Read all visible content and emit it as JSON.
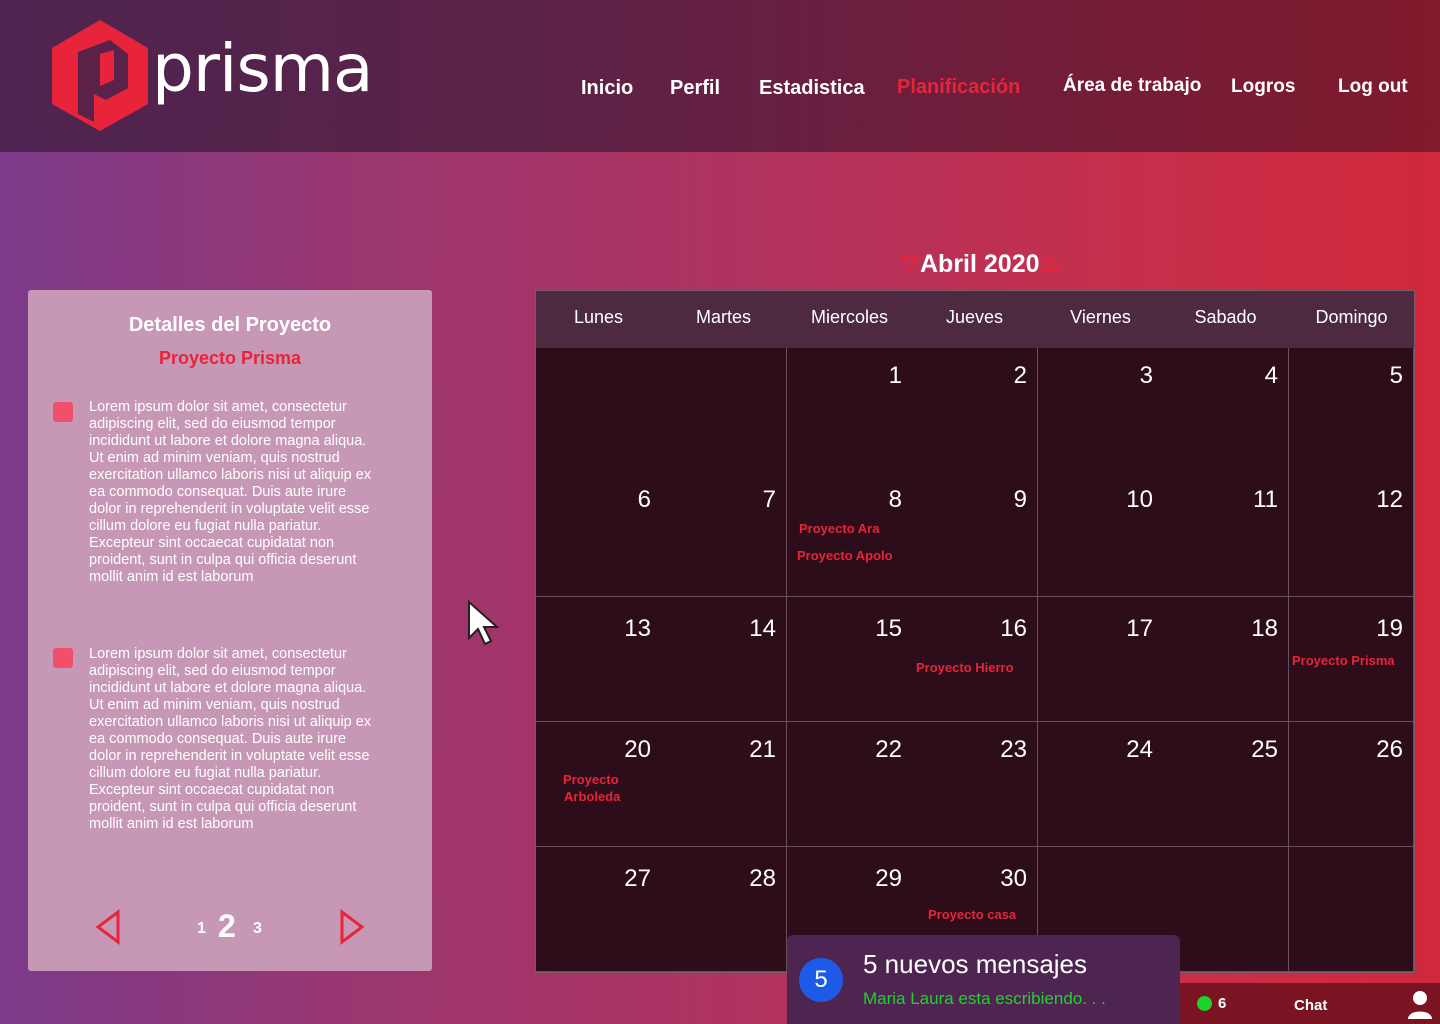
{
  "brand": {
    "name": "prisma",
    "colors": {
      "accent": "#e8243a",
      "header": "#5a2248",
      "cell": "#2e0d1a"
    }
  },
  "nav": [
    {
      "label": "Inicio"
    },
    {
      "label": "Perfil"
    },
    {
      "label": "Estadistica"
    },
    {
      "label": "Planificación",
      "active": true
    },
    {
      "label": "Área de trabajo"
    },
    {
      "label": "Logros"
    },
    {
      "label": "Log out"
    }
  ],
  "calendar": {
    "month": "Abril 2020",
    "days": [
      "Lunes",
      "Martes",
      "Miercoles",
      "Jueves",
      "Viernes",
      "Sabado",
      "Domingo"
    ],
    "weeks": [
      [
        "",
        "",
        "1",
        "2",
        "3",
        "4",
        "5"
      ],
      [
        "6",
        "7",
        "8",
        "9",
        "10",
        "11",
        "12"
      ],
      [
        "13",
        "14",
        "15",
        "16",
        "17",
        "18",
        "19"
      ],
      [
        "20",
        "21",
        "22",
        "23",
        "24",
        "25",
        "26"
      ],
      [
        "27",
        "28",
        "29",
        "30",
        "",
        "",
        ""
      ]
    ],
    "events": {
      "e8a": "Proyecto Ara",
      "e8b": "Proyecto Apolo",
      "e16": "Proyecto Hierro",
      "e19": "Proyecto Prisma",
      "e20a": "Proyecto",
      "e20b": "Arboleda",
      "e30": "Proyecto casa"
    }
  },
  "panel": {
    "title": "Detalles del Proyecto",
    "project": "Proyecto Prisma",
    "paragraph1": "Lorem ipsum dolor sit amet, consectetur adipiscing elit, sed do eiusmod tempor incididunt ut labore et dolore magna aliqua. Ut enim ad minim veniam, quis nostrud exercitation ullamco laboris nisi ut aliquip ex ea commodo consequat. Duis aute irure dolor in reprehenderit in voluptate velit esse cillum dolore eu fugiat nulla pariatur. Excepteur sint occaecat cupidatat non proident, sunt in culpa qui officia deserunt mollit anim id est laborum",
    "paragraph2": "Lorem ipsum dolor sit amet, consectetur adipiscing elit, sed do eiusmod tempor incididunt ut labore et dolore magna aliqua. Ut enim ad minim veniam, quis nostrud exercitation ullamco laboris nisi ut aliquip ex ea commodo consequat. Duis aute irure dolor in reprehenderit in voluptate velit esse cillum dolore eu fugiat nulla pariatur. Excepteur sint occaecat cupidatat non proident, sunt in culpa qui officia deserunt mollit anim id est laborum",
    "pages": [
      "1",
      "2",
      "3"
    ],
    "current_page": "2"
  },
  "chat": {
    "badge": "5",
    "title": "5 nuevos mensajes",
    "typing": "Maria Laura esta escribiendo. . .",
    "online_count": "6",
    "label": "Chat"
  }
}
